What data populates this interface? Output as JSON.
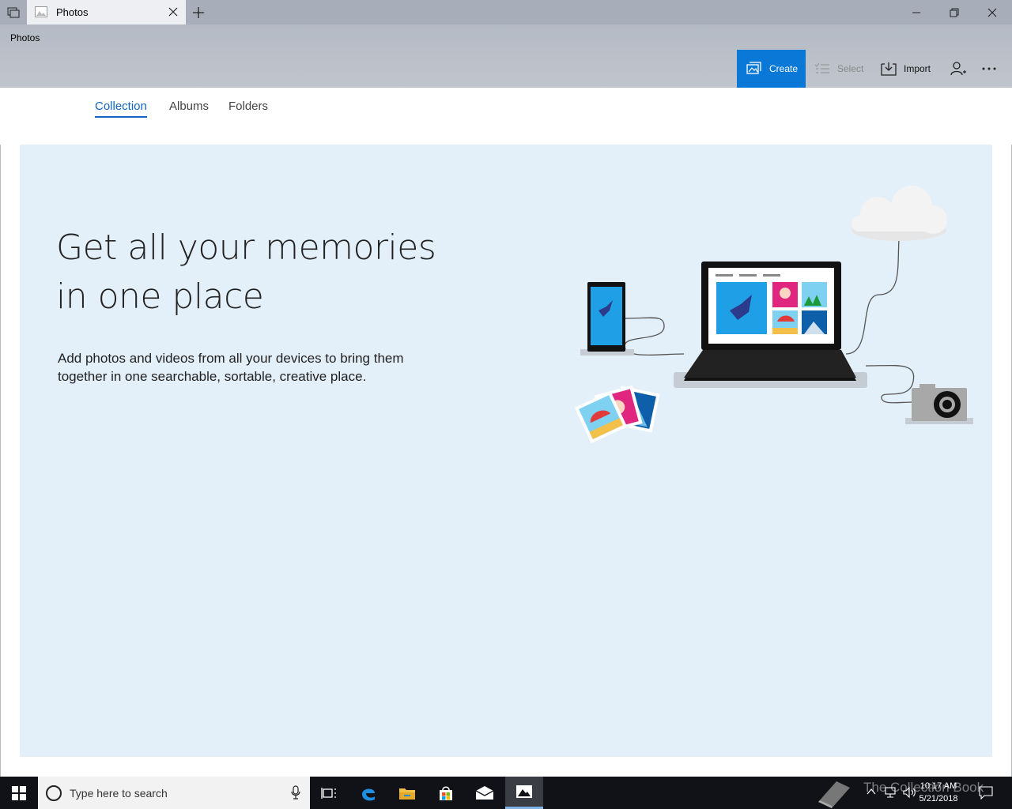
{
  "window": {
    "tab_title": "Photos",
    "app_title": "Photos"
  },
  "commands": {
    "create": "Create",
    "select": "Select",
    "import": "Import"
  },
  "nav": {
    "tabs": [
      "Collection",
      "Albums",
      "Folders"
    ],
    "active": "Collection"
  },
  "hero": {
    "title": "Get all your memories in one place",
    "description": "Add photos and videos from all your devices to bring them together in one searchable, sortable, creative place."
  },
  "taskbar": {
    "search_placeholder": "Type here to search",
    "time": "10:17 AM",
    "date": "5/21/2018",
    "watermark": "The Collection Book",
    "pinned": [
      "task-view-icon",
      "edge-icon",
      "file-explorer-icon",
      "store-icon",
      "mail-icon",
      "photos-icon"
    ]
  },
  "colors": {
    "accent": "#0a78d7",
    "hero_bg": "#e3eff9",
    "titlebar": "#a7adb9"
  }
}
